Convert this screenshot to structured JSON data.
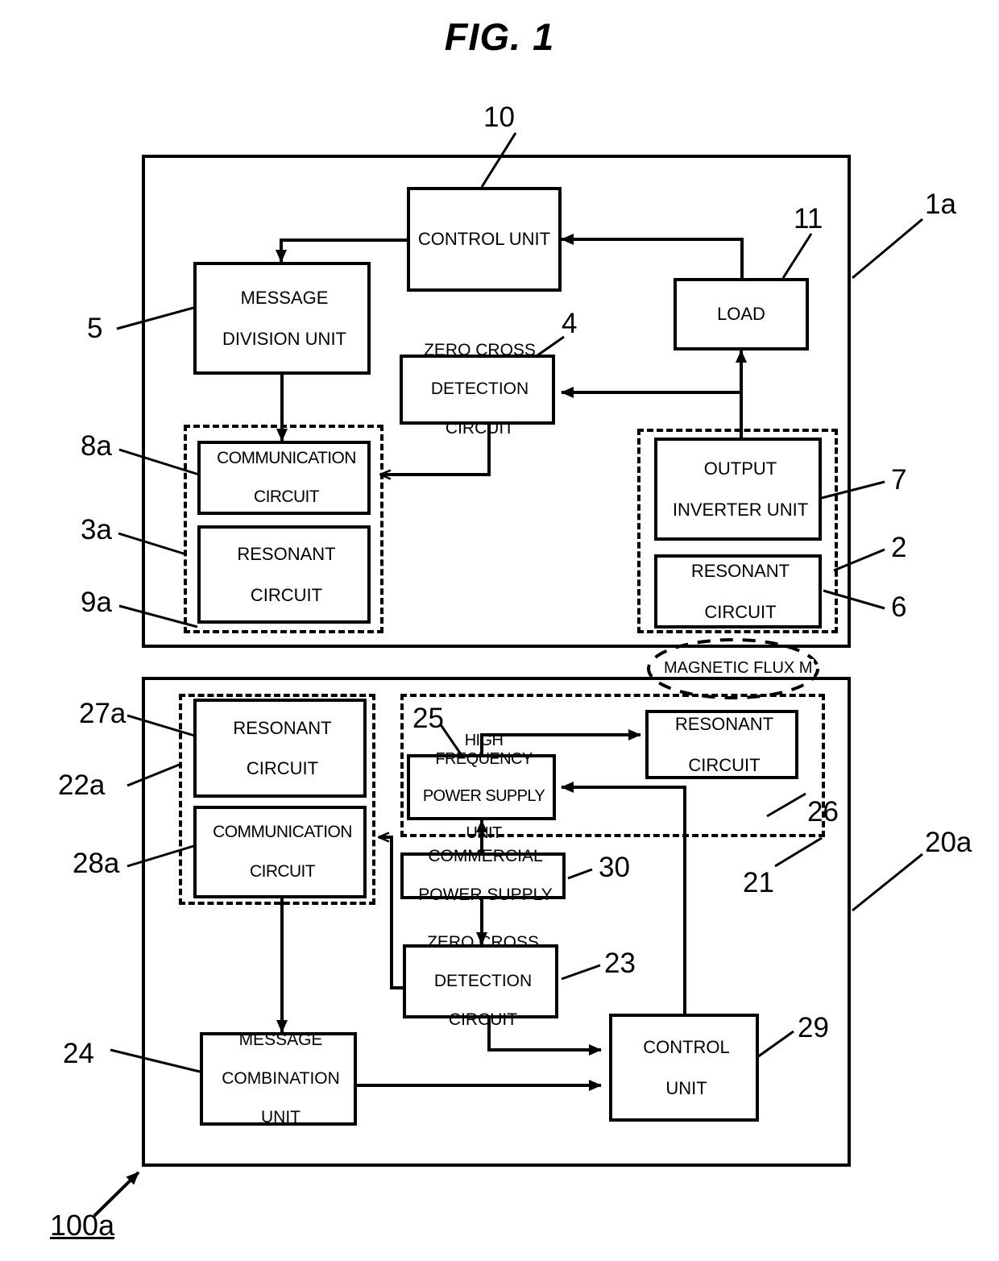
{
  "figure": {
    "title": "FIG. 1",
    "system_label": "100a",
    "flux_label": "MAGNETIC FLUX M"
  },
  "top_unit": {
    "ref": "1a",
    "blocks": {
      "control_unit": {
        "label": "CONTROL UNIT",
        "ref": "10"
      },
      "message_division_unit": {
        "label": "MESSAGE DIVISION UNIT",
        "ref": "5"
      },
      "zero_cross_detection_circuit": {
        "label": "ZERO CROSS DETECTION CIRCUIT",
        "ref": "4"
      },
      "load": {
        "label": "LOAD",
        "ref": "11"
      },
      "communication_circuit": {
        "label": "COMMUNICATION CIRCUIT",
        "ref": "8a"
      },
      "resonant_circuit_left": {
        "label": "RESONANT CIRCUIT",
        "ref": "9a"
      },
      "output_inverter_unit": {
        "label": "OUTPUT INVERTER UNIT",
        "ref": "7"
      },
      "resonant_circuit_right": {
        "label": "RESONANT CIRCUIT",
        "ref": "6"
      }
    },
    "groups": {
      "communication_group": {
        "ref": "3a"
      },
      "power_transmission_group": {
        "ref": "2"
      }
    }
  },
  "bottom_unit": {
    "ref": "20a",
    "blocks": {
      "resonant_circuit_left": {
        "label": "RESONANT CIRCUIT",
        "ref": "27a"
      },
      "communication_circuit": {
        "label": "COMMUNICATION CIRCUIT",
        "ref": "28a"
      },
      "high_frequency_power_supply_unit": {
        "label": "HIGH FREQUENCY POWER SUPPLY UNIT",
        "ref": "25"
      },
      "resonant_circuit_right": {
        "label": "RESONANT CIRCUIT",
        "ref": "26"
      },
      "commercial_power_supply": {
        "label": "COMMERCIAL POWER SUPPLY",
        "ref": "30"
      },
      "zero_cross_detection_circuit": {
        "label": "ZERO CROSS DETECTION CIRCUIT",
        "ref": "23"
      },
      "message_combination_unit": {
        "label": "MESSAGE COMBINATION UNIT",
        "ref": "24"
      },
      "control_unit": {
        "label": "CONTROL UNIT",
        "ref": "29"
      }
    },
    "groups": {
      "communication_group": {
        "ref": "22a"
      },
      "power_supply_group": {
        "ref": "21"
      }
    }
  },
  "labels": {
    "control_unit": "CONTROL UNIT",
    "message_division_unit_l1": "MESSAGE",
    "message_division_unit_l2": "DIVISION UNIT",
    "zero_cross_l1": "ZERO CROSS",
    "zero_cross_l2": "DETECTION",
    "zero_cross_l3": "CIRCUIT",
    "load": "LOAD",
    "communication_l1": "COMMUNICATION",
    "communication_l2": "CIRCUIT",
    "resonant_l1": "RESONANT",
    "resonant_l2": "CIRCUIT",
    "output_inverter_l1": "OUTPUT",
    "output_inverter_l2": "INVERTER UNIT",
    "hf_power_l1": "HIGH FREQUENCY",
    "hf_power_l2": "POWER SUPPLY",
    "hf_power_l3": "UNIT",
    "commercial_l1": "COMMERCIAL",
    "commercial_l2": "POWER SUPPLY",
    "msg_comb_l1": "MESSAGE",
    "msg_comb_l2": "COMBINATION",
    "msg_comb_l3": "UNIT",
    "control_unit_l1": "CONTROL",
    "control_unit_l2": "UNIT"
  }
}
